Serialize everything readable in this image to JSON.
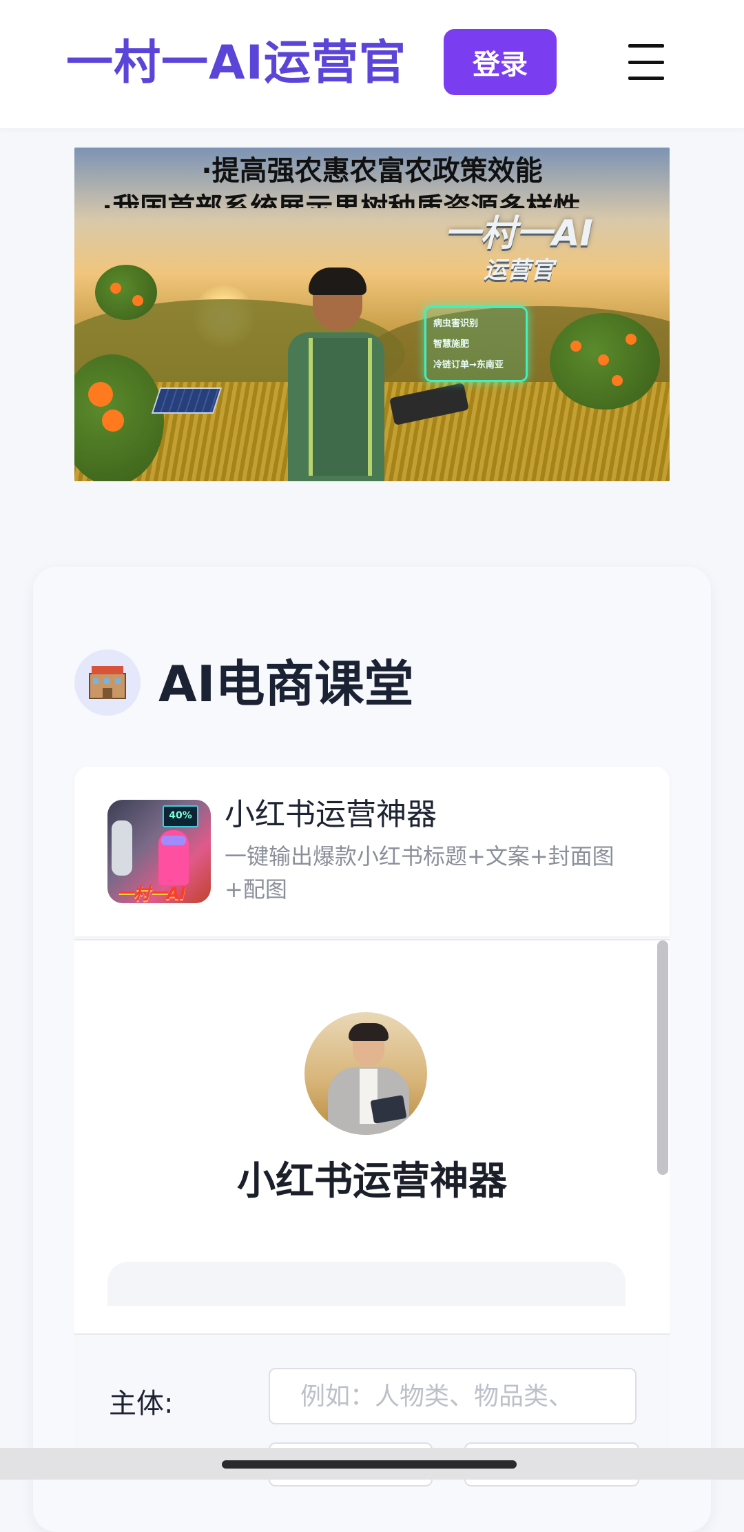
{
  "header": {
    "brand": "一村一AI运营官",
    "login_label": "登录",
    "menu_icon": "hamburger-menu-icon"
  },
  "banner": {
    "line1": "·提高强农惠农富农政策效能",
    "line2": "·我国首部系统展示果树种质资源多样性",
    "badge_title": "一村一AI",
    "badge_sub": "运营官",
    "holo_items": [
      "病虫害识别",
      "智慧施肥",
      "冷链订单→东南亚"
    ]
  },
  "section": {
    "icon": "building-icon",
    "title": "AI电商课堂"
  },
  "tool": {
    "thumb_screen": "40%",
    "thumb_logo": "一村一AI",
    "title": "小红书运营神器",
    "description": "一键输出爆款小红书标题+文案+封面图+配图"
  },
  "preview": {
    "title": "小红书运营神器"
  },
  "form": {
    "subject_label": "主体:",
    "subject_placeholder": "例如：人物类、物品类、"
  },
  "colors": {
    "brand": "#5b44d8",
    "login_button": "#7a3df0",
    "background": "#f6f7fb"
  }
}
